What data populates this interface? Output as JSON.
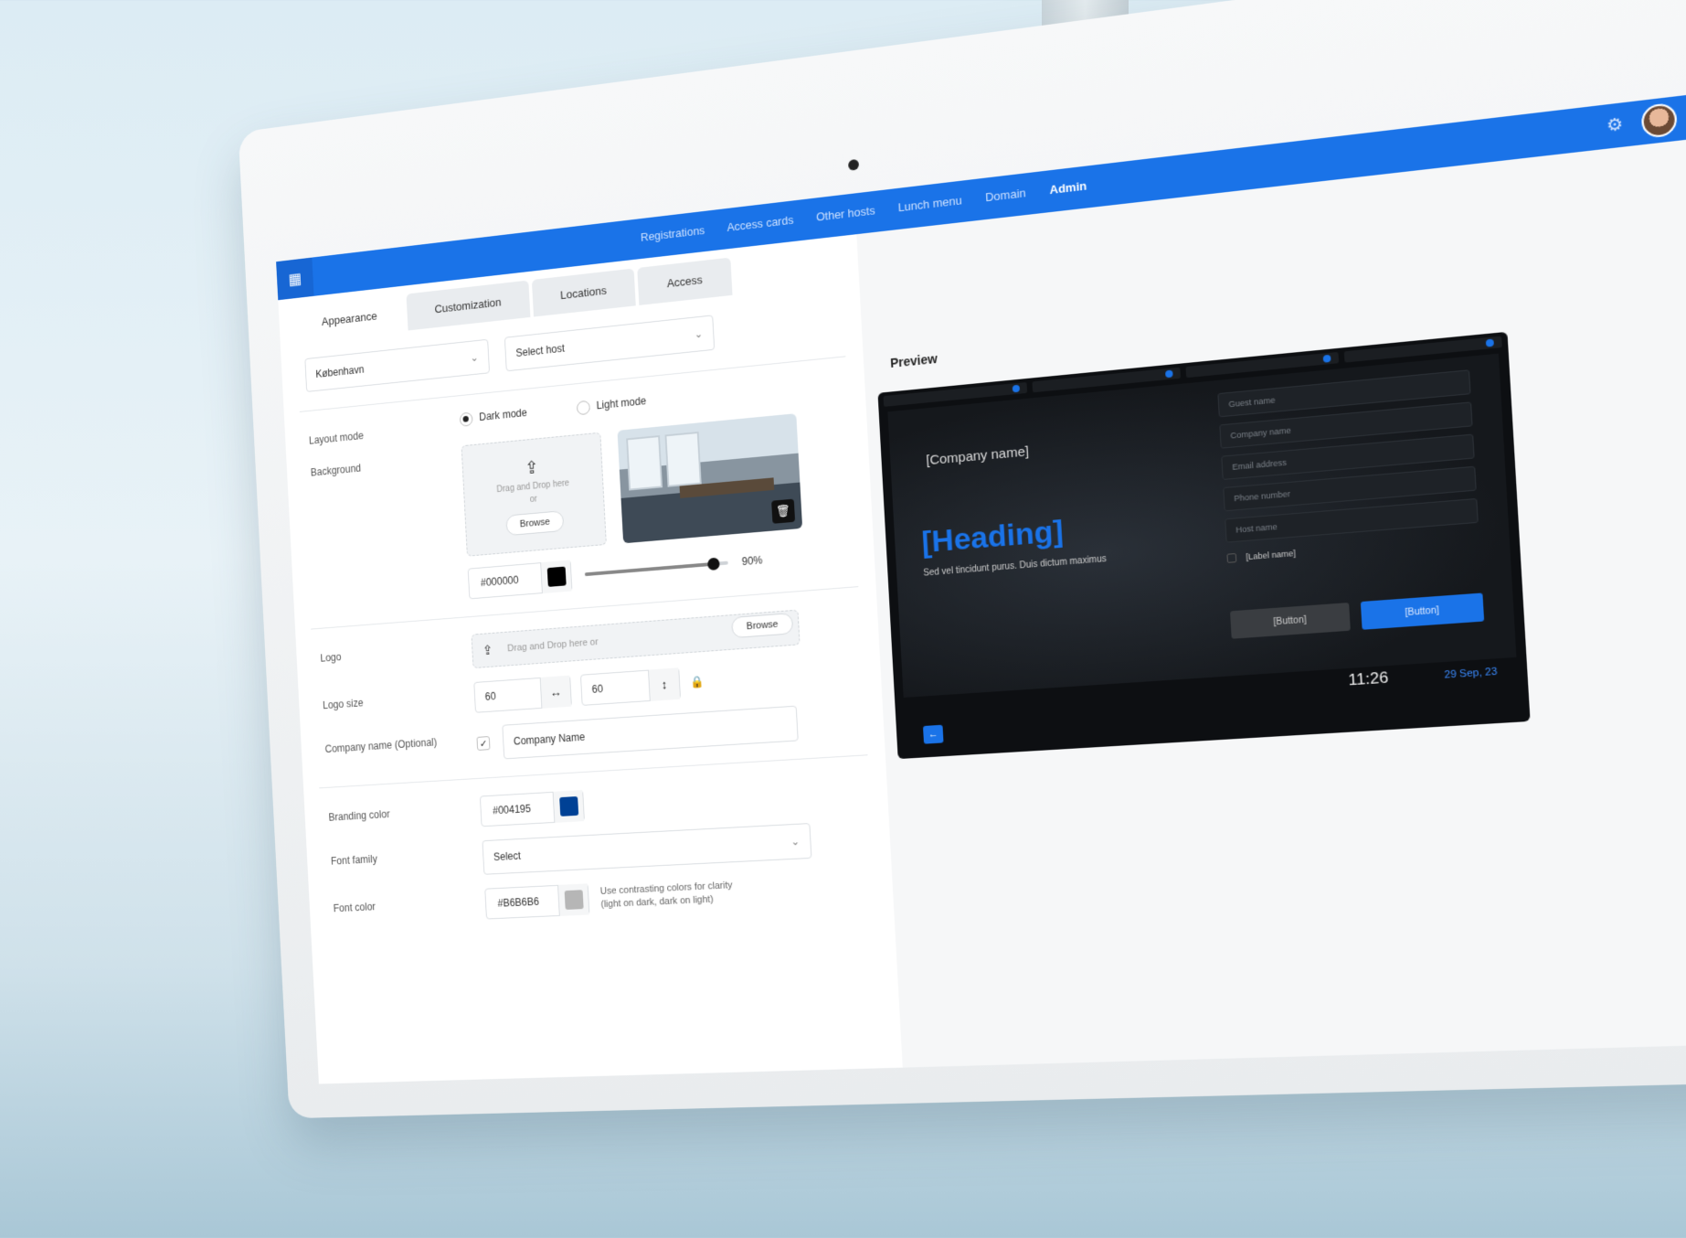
{
  "topnav": {
    "items": [
      "Registrations",
      "Access cards",
      "Other hosts",
      "Lunch menu",
      "Domain",
      "Admin"
    ],
    "active": "Admin"
  },
  "icons": {
    "apps": "grid-icon",
    "settings": "gear-icon",
    "upload": "upload-icon",
    "trash": "trash-icon",
    "width_arrow": "horizontal-arrows-icon",
    "height_arrow": "vertical-arrows-icon",
    "lock": "lock-icon",
    "check": "checkmark-icon",
    "back": "arrow-left-icon"
  },
  "tabs": {
    "appearance": "Appearance",
    "customization": "Customization",
    "locations": "Locations",
    "access": "Access"
  },
  "selects": {
    "location": "København",
    "host_placeholder": "Select host"
  },
  "layout_mode": {
    "label": "Layout mode",
    "dark": "Dark mode",
    "light": "Light mode",
    "selected": "Dark mode"
  },
  "background": {
    "label": "Background",
    "drop_text": "Drag and Drop here",
    "or_text": "or",
    "browse": "Browse",
    "color_hex": "#000000",
    "color": "#000000",
    "opacity_pct": 90,
    "opacity_label": "90%"
  },
  "logo": {
    "label": "Logo",
    "drop_text": "Drag and Drop here or",
    "browse": "Browse",
    "size_label": "Logo size",
    "width": "60",
    "height": "60"
  },
  "company_name": {
    "label": "Company name (Optional)",
    "checked": true,
    "value": "Company Name"
  },
  "branding": {
    "label": "Branding color",
    "hex": "#004195",
    "color": "#004195"
  },
  "font_family": {
    "label": "Font family",
    "value": "Select"
  },
  "font_color": {
    "label": "Font color",
    "hex": "#B6B6B6",
    "color": "#B6B6B6",
    "hint": "Use contrasting colors for clarity (light on dark, dark on light)"
  },
  "preview": {
    "label": "Preview",
    "company": "[Company name]",
    "heading": "[Heading]",
    "subtext": "Sed vel tincidunt purus. Duis dictum maximus",
    "fields": [
      "Guest name",
      "Company name",
      "Email address",
      "Phone number",
      "Host name"
    ],
    "checkbox_label": "[Label name]",
    "button_secondary": "[Button]",
    "button_primary": "[Button]",
    "time": "11:26",
    "date": "29 Sep, 23"
  },
  "colors": {
    "accent": "#1a73e8"
  }
}
